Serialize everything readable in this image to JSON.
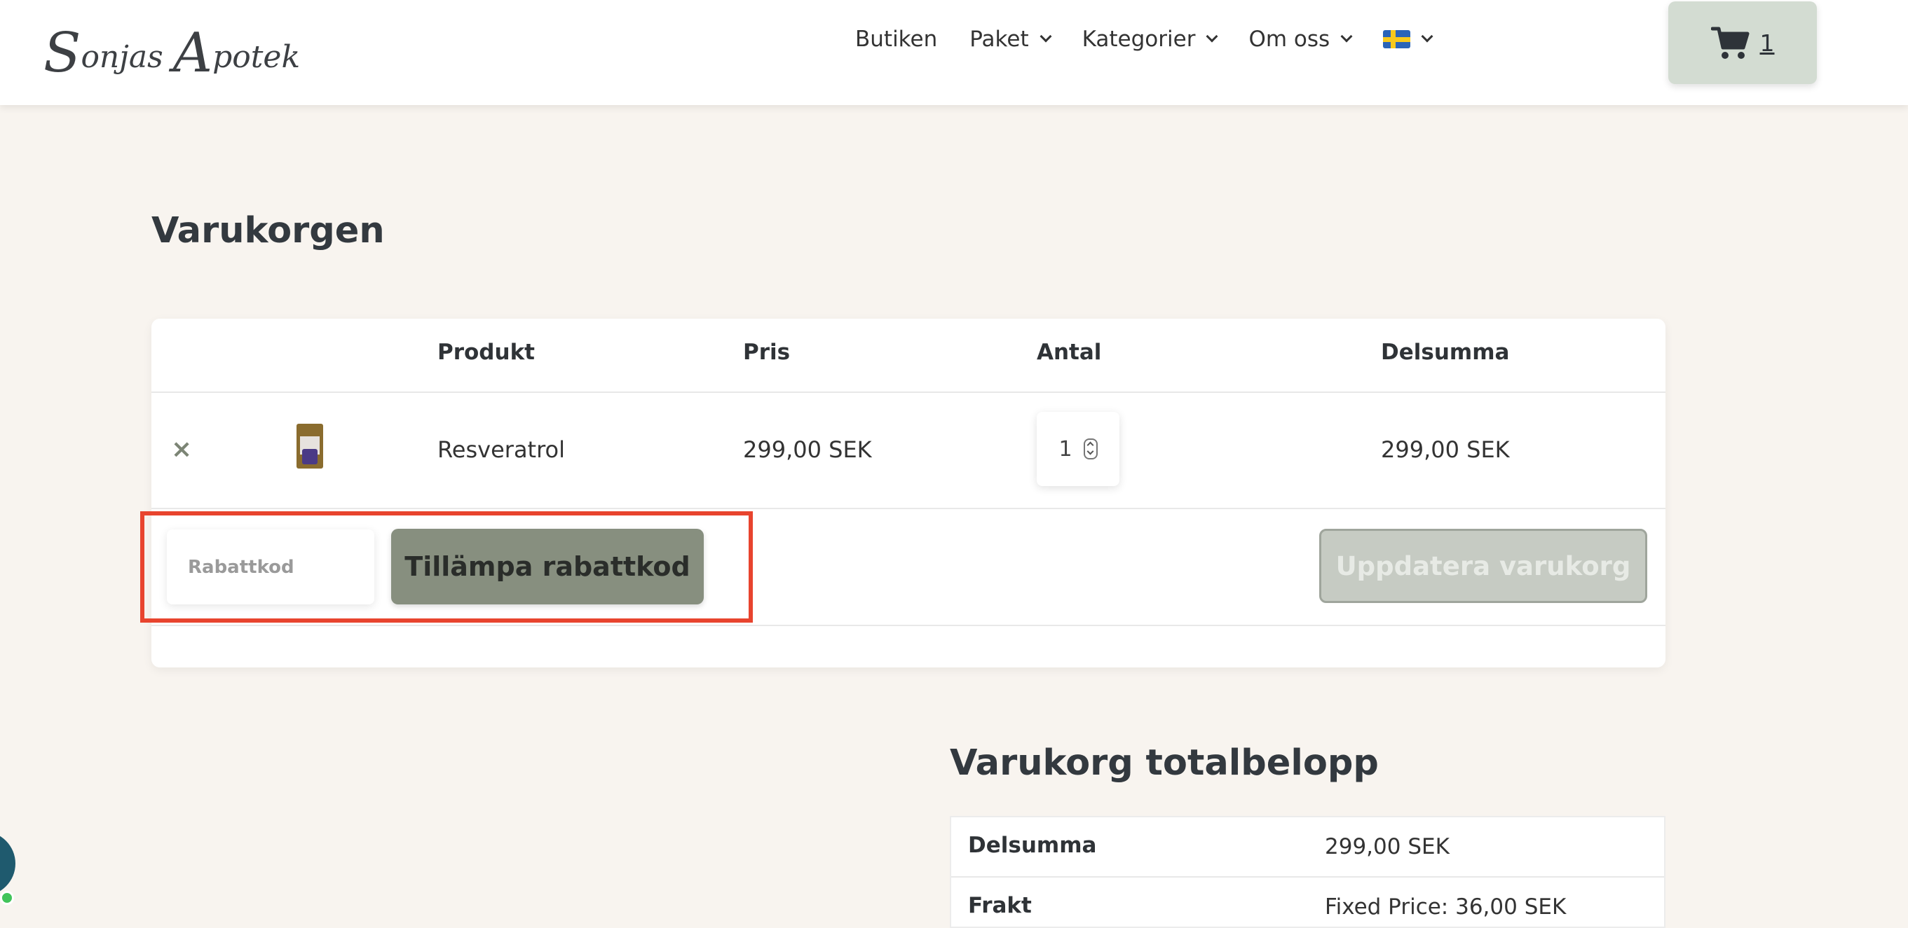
{
  "header": {
    "logo_cap1": "S",
    "logo_rest1": "onjas ",
    "logo_cap2": "A",
    "logo_rest2": "potek",
    "nav": [
      {
        "label": "Butiken"
      },
      {
        "label": "Paket"
      },
      {
        "label": "Kategorier"
      },
      {
        "label": "Om oss"
      }
    ],
    "language_flag": "sweden-flag-icon",
    "cart_count": "1"
  },
  "cart": {
    "title": "Varukorgen",
    "columns": [
      "",
      "",
      "Produkt",
      "Pris",
      "Antal",
      "Delsumma"
    ],
    "rows": [
      {
        "remove": "×",
        "product": "Resveratrol",
        "price": "299,00 SEK",
        "quantity": "1",
        "subtotal": "299,00 SEK"
      }
    ],
    "coupon_placeholder": "Rabattkod",
    "apply_coupon_label": "Tillämpa rabattkod",
    "update_cart_label": "Uppdatera varukorg"
  },
  "totals": {
    "title": "Varukorg totalbelopp",
    "rows": [
      {
        "label": "Delsumma",
        "value": "299,00 SEK"
      },
      {
        "label": "Frakt",
        "value": "Fixed Price: 36,00 SEK"
      }
    ]
  },
  "colors": {
    "page_background": "#f8f4ef",
    "cart_button": "#d3dcd2",
    "apply_button": "#878f7f",
    "update_button": "#c6cbc3",
    "highlight_box": "#e8442e"
  }
}
